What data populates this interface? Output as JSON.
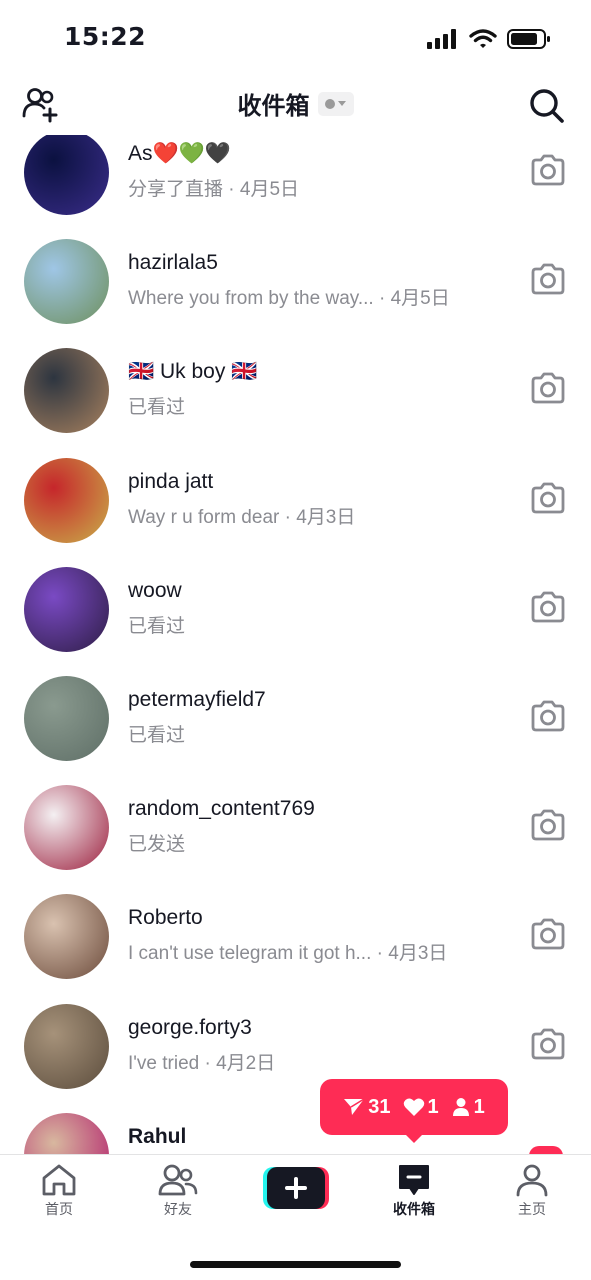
{
  "status_bar": {
    "time": "15:22"
  },
  "header": {
    "title": "收件箱"
  },
  "conversations": [
    {
      "name": "As❤️💚🖤",
      "subtitle": "分享了直播 · 4月5日",
      "avatar_colors": [
        "#0b1140",
        "#3a2d8a"
      ]
    },
    {
      "name": "hazirlala5",
      "subtitle": "Where you from by the way... · 4月5日",
      "avatar_colors": [
        "#9fc6e6",
        "#6d8f5c"
      ]
    },
    {
      "name": "🇬🇧 Uk boy 🇬🇧",
      "subtitle": "已看过",
      "avatar_colors": [
        "#2d3540",
        "#a9825f"
      ]
    },
    {
      "name": "pinda jatt",
      "subtitle": "Way r u form dear · 4月3日",
      "avatar_colors": [
        "#c6262b",
        "#c9b04a"
      ]
    },
    {
      "name": "woow",
      "subtitle": "已看过",
      "avatar_colors": [
        "#7a4ac4",
        "#2d1d44"
      ]
    },
    {
      "name": "petermayfield7",
      "subtitle": "已看过",
      "avatar_colors": [
        "#8a9a8f",
        "#5e6e66"
      ]
    },
    {
      "name": "random_content769",
      "subtitle": "已发送",
      "avatar_colors": [
        "#f4f0f2",
        "#9c1f3d"
      ]
    },
    {
      "name": "Roberto",
      "subtitle": "I can't use telegram it got h...  · 4月3日",
      "avatar_colors": [
        "#d9c2b0",
        "#6b4a3a"
      ]
    },
    {
      "name": "george.forty3",
      "subtitle": "I've tried · 4月2日",
      "avatar_colors": [
        "#a6927a",
        "#5b4c3c"
      ]
    },
    {
      "name": "Rahul",
      "subtitle": "",
      "avatar_colors": [
        "#d8b89f",
        "#b0186a"
      ]
    }
  ],
  "notification": {
    "shares": "31",
    "likes": "1",
    "followers": "1"
  },
  "bottom_nav": {
    "home": "首页",
    "friends": "好友",
    "inbox": "收件箱",
    "profile": "主页"
  },
  "colors": {
    "accent": "#fe2c55",
    "text": "#161823",
    "muted": "#8a8b91"
  }
}
